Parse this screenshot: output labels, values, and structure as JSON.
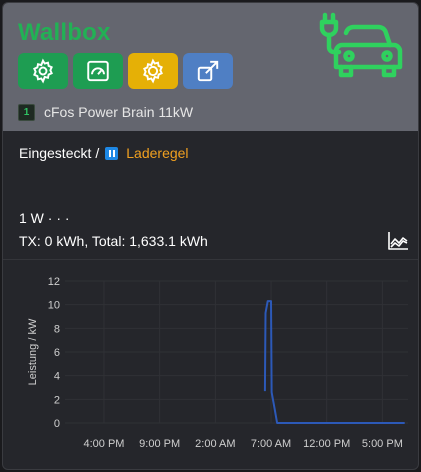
{
  "widget": {
    "title": "Wallbox",
    "device_number": "1",
    "device_name": "cFos Power Brain 11kW",
    "colors": {
      "title": "#22b155",
      "car_icon": "#2fd15e"
    }
  },
  "buttons": [
    {
      "icon": "gear-icon",
      "color": "#1e9d52"
    },
    {
      "icon": "meter-icon",
      "color": "#1e9d52"
    },
    {
      "icon": "sun-gear-icon",
      "color": "#e5b006"
    },
    {
      "icon": "external-link-icon",
      "color": "#4f7fc4"
    }
  ],
  "status": {
    "state": "Eingesteckt",
    "separator": "/",
    "mode_icon": "pause-icon",
    "mode": "Laderegel"
  },
  "metrics": {
    "power": "1 W · · ·",
    "energy": "TX: 0 kWh, Total: 1,633.1 kWh"
  },
  "chart_data": {
    "type": "line",
    "ylabel": "Leistung / kW",
    "xlabel": "",
    "ylim": [
      0,
      12
    ],
    "y_ticks": [
      "0",
      "2",
      "4",
      "6",
      "8",
      "10",
      "12"
    ],
    "x_ticks": [
      "4:00 PM",
      "9:00 PM",
      "2:00 AM",
      "7:00 AM",
      "12:00 PM",
      "5:00 PM"
    ],
    "x_tick_hours": [
      16,
      21,
      26,
      31,
      36,
      41
    ],
    "xlim_hours": [
      12.5,
      43.3
    ],
    "grid": true,
    "series": [
      {
        "color": "#2c59b8",
        "points": [
          [
            30.45,
            2.7
          ],
          [
            30.5,
            9.3
          ],
          [
            30.7,
            10.3
          ],
          [
            31.0,
            10.3
          ],
          [
            31.05,
            2.6
          ],
          [
            31.3,
            1.3
          ],
          [
            31.55,
            0.0
          ],
          [
            43.0,
            0.0
          ]
        ]
      }
    ]
  }
}
